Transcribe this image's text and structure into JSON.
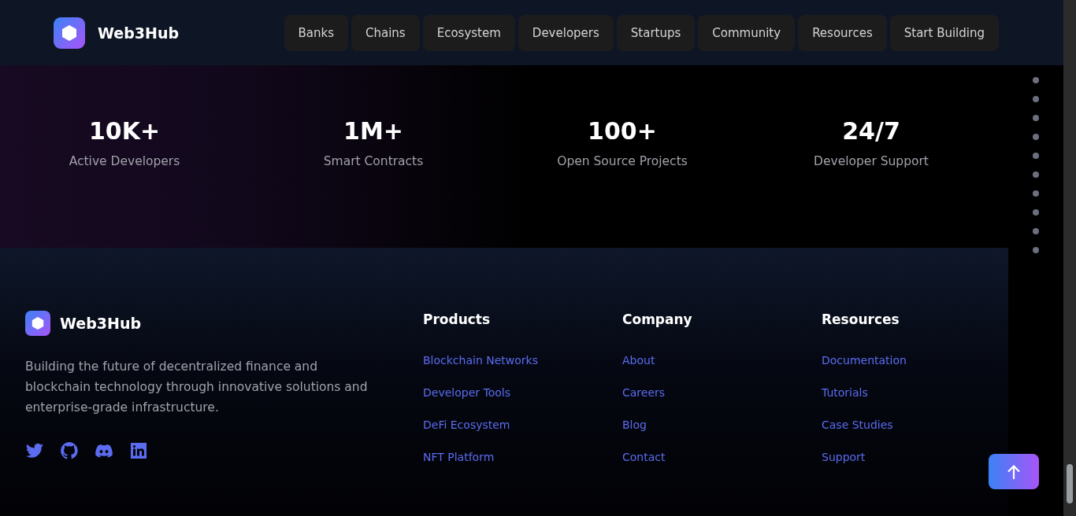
{
  "header": {
    "brand": "Web3Hub",
    "nav": [
      "Banks",
      "Chains",
      "Ecosystem",
      "Developers",
      "Startups",
      "Community",
      "Resources",
      "Start Building"
    ]
  },
  "stats": [
    {
      "value": "10K+",
      "label": "Active Developers"
    },
    {
      "value": "1M+",
      "label": "Smart Contracts"
    },
    {
      "value": "100+",
      "label": "Open Source Projects"
    },
    {
      "value": "24/7",
      "label": "Developer Support"
    }
  ],
  "footer": {
    "brand": "Web3Hub",
    "description": "Building the future of decentralized finance and blockchain technology through innovative solutions and enterprise-grade infrastructure.",
    "social": [
      {
        "kind": "twitter"
      },
      {
        "kind": "github"
      },
      {
        "kind": "discord"
      },
      {
        "kind": "linkedin"
      }
    ],
    "columns": [
      {
        "title": "Products",
        "links": [
          "Blockchain Networks",
          "Developer Tools",
          "DeFi Ecosystem",
          "NFT Platform"
        ]
      },
      {
        "title": "Company",
        "links": [
          "About",
          "Careers",
          "Blog",
          "Contact"
        ]
      },
      {
        "title": "Resources",
        "links": [
          "Documentation",
          "Tutorials",
          "Case Studies",
          "Support"
        ]
      }
    ]
  }
}
